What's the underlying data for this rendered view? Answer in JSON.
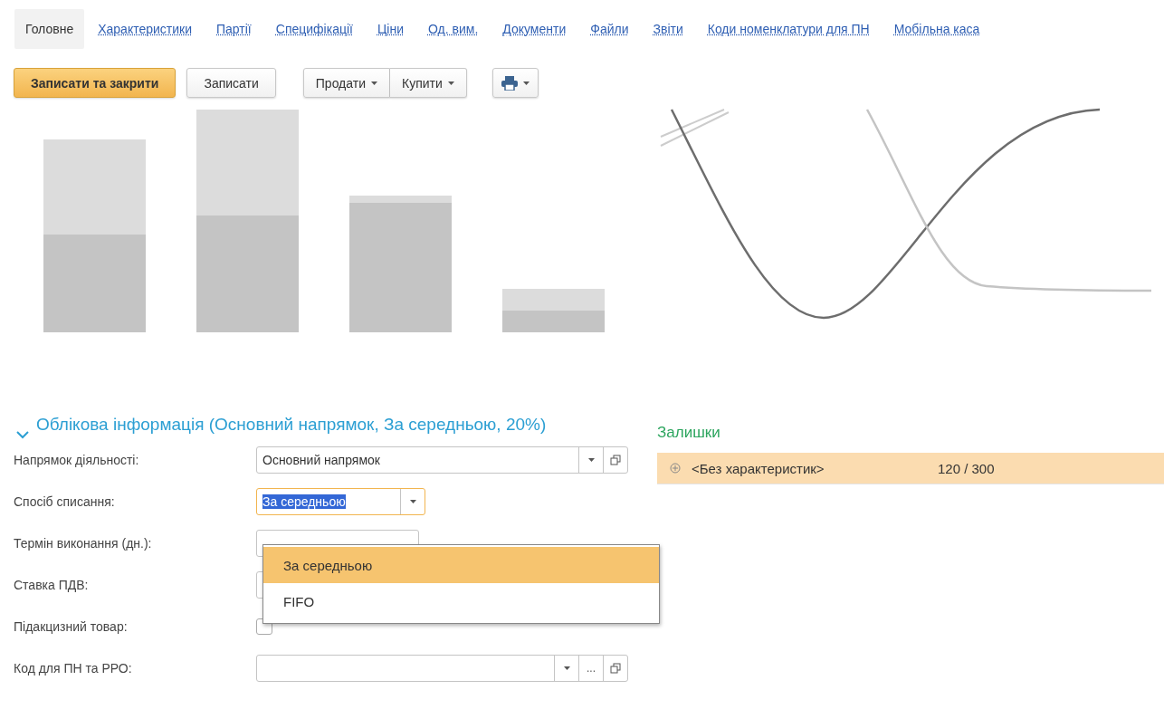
{
  "tabs": [
    {
      "label": "Головне",
      "selected": true
    },
    {
      "label": "Характеристики",
      "selected": false
    },
    {
      "label": "Партії",
      "selected": false
    },
    {
      "label": "Специфікації",
      "selected": false
    },
    {
      "label": "Ціни",
      "selected": false
    },
    {
      "label": "Од. вим.",
      "selected": false
    },
    {
      "label": "Документи",
      "selected": false
    },
    {
      "label": "Файли",
      "selected": false
    },
    {
      "label": "Звіти",
      "selected": false
    },
    {
      "label": "Коди номенклатури для ПН",
      "selected": false
    },
    {
      "label": "Мобільна каса",
      "selected": false
    }
  ],
  "toolbar": {
    "primary": "Записати та закрити",
    "save": "Записати",
    "group": [
      "Продати",
      "Купити"
    ]
  },
  "section": {
    "title": "Облікова інформація (Основний напрямок, За середньою, 20%)",
    "expanded": true,
    "fields": [
      {
        "label": "Напрямок діяльності:",
        "kind": "select",
        "value": "Основний напрямок"
      },
      {
        "label": "Спосіб списання:",
        "kind": "focused",
        "value": "За середньою"
      },
      {
        "label": "Термін виконання (дн.):",
        "kind": "input"
      },
      {
        "label": "Ставка ПДВ:",
        "kind": "input"
      },
      {
        "label": "Підакцизний товар:",
        "kind": "checkbox",
        "checked": false
      },
      {
        "label": "Код для ПН та РРО:",
        "kind": "select-more",
        "more": "..."
      }
    ]
  },
  "dropdown": [
    {
      "label": "За середньою",
      "selected": true
    },
    {
      "label": "FIFO",
      "selected": false
    }
  ],
  "stock": {
    "title": "Залишки",
    "rows": [
      {
        "name": "<Без характеристик>",
        "amount": "120 / 300",
        "selected": true
      }
    ]
  }
}
